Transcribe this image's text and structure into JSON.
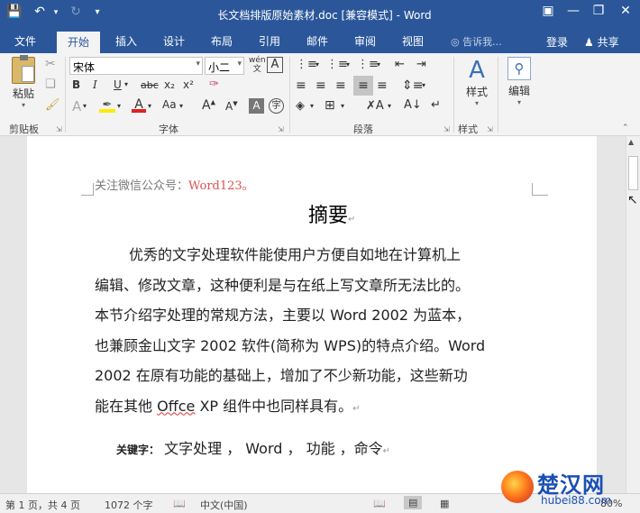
{
  "titlebar": {
    "title": "长文档排版原始素材.doc [兼容模式] - Word",
    "save_icon": "save-icon",
    "undo_icon": "undo-icon",
    "redo_icon": "redo-icon"
  },
  "tabs": {
    "file": "文件",
    "home": "开始",
    "insert": "插入",
    "design": "设计",
    "layout": "布局",
    "references": "引用",
    "mailings": "邮件",
    "review": "审阅",
    "view": "视图",
    "tell_me": "告诉我...",
    "login": "登录",
    "share": "共享"
  },
  "ribbon": {
    "paste": "粘贴",
    "font_name": "宋体",
    "font_size": "小二",
    "styles": "样式",
    "editing": "编辑",
    "groups": {
      "clipboard": "剪贴板",
      "font": "字体",
      "paragraph": "段落",
      "styles": "样式"
    },
    "buttons": {
      "bold": "B",
      "italic": "I",
      "underline": "U",
      "strike": "abc",
      "subscript": "x₂",
      "superscript": "x²",
      "change_case": "Aa"
    }
  },
  "document": {
    "header_prefix": "关注微信公众号：",
    "header_account": "Word123",
    "header_suffix": "。",
    "title": "摘要",
    "lines": [
      "优秀的文字处理软件能使用户方便自如地在计算机上",
      "编辑、修改文章，这种便利是与在纸上写文章所无法比的。",
      "本节介绍字处理的常规方法，主要以 Word 2002 为蓝本，",
      "也兼顾金山文字 2002 软件(简称为 WPS)的特点介绍。Word",
      "2002 在原有功能的基础上，增加了不少新功能，这些新功"
    ],
    "last_line_prefix": "能在其他 ",
    "last_line_misspelled": "Offce",
    "last_line_suffix": " XP 组件中也同样具有。",
    "keywords_label": "关键字：",
    "keywords_text": "文字处理 ， Word ， 功能 ，命令"
  },
  "status": {
    "page": "第 1 页，共 4 页",
    "words": "1072 个字",
    "language": "中文(中国)",
    "zoom": "80%"
  },
  "watermark": {
    "text": "楚汉网",
    "url": "hubei88.com"
  },
  "colors": {
    "word_blue": "#2b579a",
    "account_red": "#d9534f"
  }
}
